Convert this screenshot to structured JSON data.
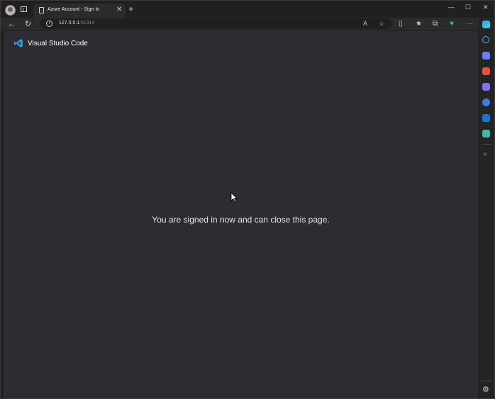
{
  "browser": {
    "tab_title": "Azure Account - Sign In",
    "url_host": "127.0.0.1",
    "url_port": ":51314",
    "new_tab": "+",
    "tab_close": "✕",
    "window_controls": {
      "minimize": "—",
      "maximize": "☐",
      "close": "✕"
    },
    "nav": {
      "back": "←",
      "refresh": "↻",
      "more": "···"
    }
  },
  "page": {
    "brand_name": "Visual Studio Code",
    "message": "You are signed in now and can close this page."
  },
  "sidebar": {
    "icons": [
      "copilot-icon",
      "search-icon",
      "shopping-tag-icon",
      "toolbox-icon",
      "games-icon",
      "office-icon",
      "outlook-icon",
      "drop-icon"
    ],
    "add": "+",
    "settings": "⚙"
  },
  "colors": {
    "page_background": "#2c2c32",
    "vscode_blue": "#2aa0f0",
    "text": "#e6e6e6"
  }
}
